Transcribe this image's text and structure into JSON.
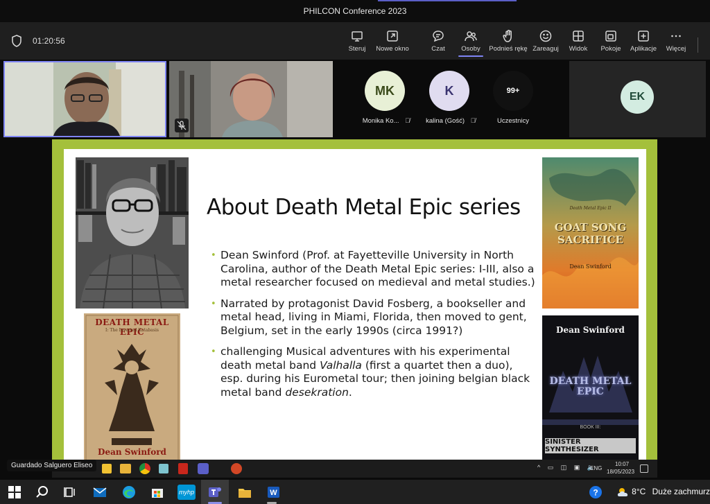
{
  "window": {
    "title": "PHILCON Conference 2023"
  },
  "toolbar": {
    "timer": "01:20:56",
    "buttons": [
      {
        "label": "Steruj",
        "icon": "share-screen-icon"
      },
      {
        "label": "Nowe okno",
        "icon": "new-window-icon"
      },
      {
        "label": "Czat",
        "icon": "chat-icon"
      },
      {
        "label": "Osoby",
        "icon": "people-icon"
      },
      {
        "label": "Podnieś rękę",
        "icon": "raise-hand-icon"
      },
      {
        "label": "Zareaguj",
        "icon": "smiley-icon"
      },
      {
        "label": "Widok",
        "icon": "grid-icon"
      },
      {
        "label": "Pokoje",
        "icon": "rooms-icon"
      },
      {
        "label": "Aplikacje",
        "icon": "plus-icon"
      },
      {
        "label": "Więcej",
        "icon": "more-icon"
      }
    ]
  },
  "participants": [
    {
      "initials": "MK",
      "name": "Monika Ko...",
      "color": "#e8f0d6",
      "text": "#3a4a1a"
    },
    {
      "initials": "K",
      "name": "kalina (Gość)",
      "color": "#e0dcf0",
      "text": "#3a3470"
    },
    {
      "initials": "99+",
      "name": "Uczestnicy",
      "color": "#111111",
      "text": "#ffffff"
    },
    {
      "initials": "EK",
      "name": "",
      "color": "#d3ece1",
      "text": "#1f4a38"
    }
  ],
  "slide": {
    "title": "About Death Metal Epic series",
    "bullet1": "Dean Swinford (Prof. at Fayetteville University in North Carolina, author of the Death Metal Epic series: I-III, also a metal researcher focused on medieval and metal studies.)",
    "bullet2": "Narrated by protagonist David Fosberg, a bookseller and metal head, living in Miami, Florida, then moved to gent, Belgium, set in the early 1990s (circa 1991?)",
    "bullet3_pre": "challenging Musical adventures with his experimental death metal band ",
    "bullet3_em1": "Valhalla",
    "bullet3_mid": " (first a quartet then a duo), esp. during his Eurometal tour; then joining belgian black metal band ",
    "bullet3_em2": "desekration",
    "bullet3_post": ".",
    "cover1_title": "DEATH METAL EPIC",
    "cover1_sub": "I: The Inverted Katabasis",
    "cover1_author": "Dean Swinford",
    "cover2_series": "Death Metal Epic II",
    "cover2_title": "GOAT SONG SACRIFICE",
    "cover2_author": "Dean Swinford",
    "cover3_author": "Dean Swinford",
    "cover3_logo": "DEATH METAL EPIC",
    "cover3_book": "BOOK III:",
    "cover3_title": "SINISTER SYNTHESIZER"
  },
  "speaker_label": "Guardado Salguero Eliseo",
  "inner_taskbar": {
    "lang": "ENG",
    "time": "10:07",
    "date": "18/05/2023"
  },
  "taskbar": {
    "temperature": "8°C",
    "weather": "Duże zachmurz"
  }
}
